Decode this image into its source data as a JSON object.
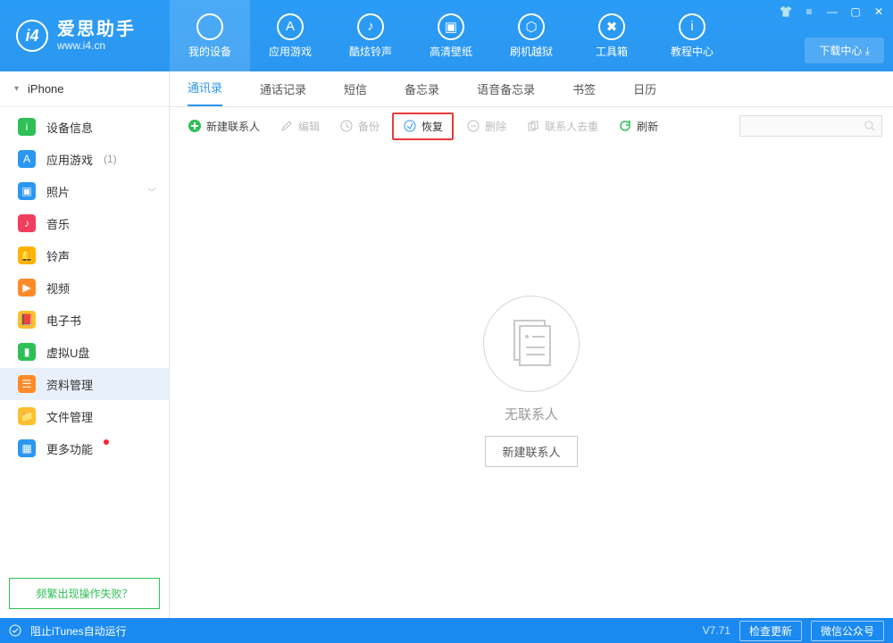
{
  "logo": {
    "mark": "i4",
    "title": "爱思助手",
    "url": "www.i4.cn"
  },
  "top_tabs": [
    {
      "label": "我的设备",
      "active": true
    },
    {
      "label": "应用游戏"
    },
    {
      "label": "酷炫铃声"
    },
    {
      "label": "高清壁纸"
    },
    {
      "label": "刷机越狱"
    },
    {
      "label": "工具箱"
    },
    {
      "label": "教程中心"
    }
  ],
  "download_center": "下载中心 ⤓",
  "window_controls": {
    "skin": "👕",
    "opts": "≡",
    "min": "—",
    "max": "▢",
    "close": "✕"
  },
  "sidebar": {
    "device": "iPhone",
    "items": [
      {
        "label": "设备信息",
        "color": "#2fbf56",
        "glyph": "i"
      },
      {
        "label": "应用游戏",
        "color": "#2b97f0",
        "glyph": "A",
        "badge": "(1)"
      },
      {
        "label": "照片",
        "color": "#2b97f0",
        "glyph": "▣",
        "chev": true
      },
      {
        "label": "音乐",
        "color": "#f23d5e",
        "glyph": "♪"
      },
      {
        "label": "铃声",
        "color": "#ffb300",
        "glyph": "🔔"
      },
      {
        "label": "视频",
        "color": "#ff8a2a",
        "glyph": "▶"
      },
      {
        "label": "电子书",
        "color": "#ffbf2f",
        "glyph": "📕"
      },
      {
        "label": "虚拟U盘",
        "color": "#2fbf56",
        "glyph": "▮"
      },
      {
        "label": "资料管理",
        "color": "#ff8a2a",
        "glyph": "☰",
        "selected": true
      },
      {
        "label": "文件管理",
        "color": "#ffbf2f",
        "glyph": "📁"
      },
      {
        "label": "更多功能",
        "color": "#2b97f0",
        "glyph": "▦",
        "dot": true
      }
    ],
    "help": "频繁出现操作失败？"
  },
  "subtabs": [
    "通讯录",
    "通话记录",
    "短信",
    "备忘录",
    "语音备忘录",
    "书签",
    "日历"
  ],
  "subtab_active": 0,
  "toolbar": {
    "new": "新建联系人",
    "edit": "编辑",
    "backup": "备份",
    "restore": "恢复",
    "delete": "删除",
    "dedup": "联系人去重",
    "refresh": "刷新"
  },
  "empty": {
    "message": "无联系人",
    "button": "新建联系人"
  },
  "status": {
    "itunes": "阻止iTunes自动运行",
    "version": "V7.71",
    "check": "检查更新",
    "wechat": "微信公众号"
  }
}
